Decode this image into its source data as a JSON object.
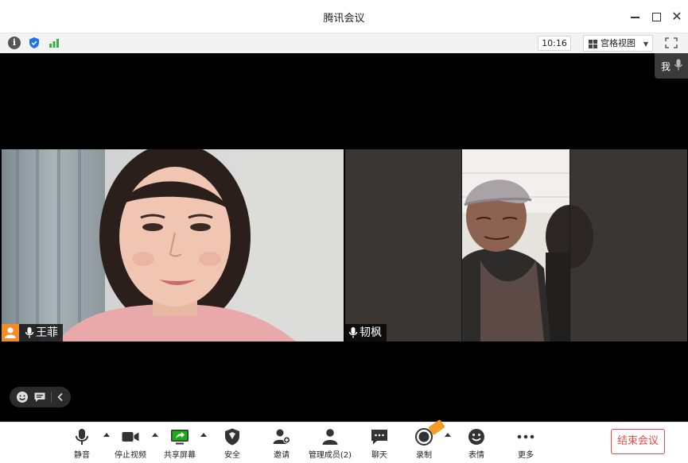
{
  "window": {
    "title": "腾讯会议"
  },
  "infobar": {
    "time": "10:16",
    "view_label": "宫格视图"
  },
  "self_chip": {
    "label": "我"
  },
  "participants": [
    {
      "name": "王菲",
      "is_host": true
    },
    {
      "name": "韧枫",
      "is_host": false
    }
  ],
  "toolbar": {
    "items": [
      {
        "label": "静音",
        "icon": "mic-icon"
      },
      {
        "label": "停止视频",
        "icon": "video-camera-icon"
      },
      {
        "label": "共享屏幕",
        "icon": "share-screen-icon"
      },
      {
        "label": "安全",
        "icon": "shield-icon"
      },
      {
        "label": "邀请",
        "icon": "add-person-icon"
      },
      {
        "label": "管理成员(2)",
        "icon": "members-icon"
      },
      {
        "label": "聊天",
        "icon": "chat-icon"
      },
      {
        "label": "录制",
        "icon": "record-icon"
      },
      {
        "label": "表情",
        "icon": "smiley-icon"
      },
      {
        "label": "更多",
        "icon": "more-dots-icon"
      }
    ],
    "end_label": "结束会议"
  },
  "colors": {
    "host_badge": "#f28c28",
    "end_button": "#e34a4a",
    "share_green": "#1aad19",
    "shield_blue": "#1a73e8",
    "signal_green": "#2fb34a"
  }
}
